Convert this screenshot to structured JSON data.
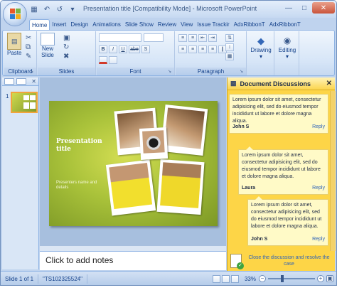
{
  "window": {
    "title": "Presentation title [Compatibility Mode] - Microsoft PowerPoint"
  },
  "tabs": [
    {
      "label": "Home",
      "active": true
    },
    {
      "label": "Insert"
    },
    {
      "label": "Design"
    },
    {
      "label": "Animations"
    },
    {
      "label": "Slide Show"
    },
    {
      "label": "Review"
    },
    {
      "label": "View"
    },
    {
      "label": "Issue Trackir"
    },
    {
      "label": "AdxRibbonT"
    },
    {
      "label": "AdxRibbonT"
    }
  ],
  "ribbon": {
    "clipboard": {
      "label": "Clipboard",
      "paste": "Paste"
    },
    "slides": {
      "label": "Slides",
      "new_slide_1": "New",
      "new_slide_2": "Slide"
    },
    "font": {
      "label": "Font",
      "bold": "B",
      "italic": "I",
      "underline": "U",
      "strike": "abe",
      "shadow": "S"
    },
    "paragraph": {
      "label": "Paragraph"
    },
    "drawing": {
      "label": "Drawing"
    },
    "editing": {
      "label": "Editing"
    }
  },
  "slide_panel": {
    "slide_number": "1"
  },
  "slide": {
    "title": "Presentation title",
    "subtitle": "Presenters name and details"
  },
  "notes": {
    "placeholder": "Click to add notes"
  },
  "task_pane": {
    "title": "Document Discussions",
    "comments": [
      {
        "text": "Lorem ipsum dolor sit amet, consectetur adipisicing elit, sed do eiusmod tempor incididunt ut labore et dolore magna aliqua.",
        "author": "John S",
        "reply": "Reply"
      },
      {
        "text": "Lorem ipsum dolor sit amet, consectetur adipisicing elit, sed do eiusmod tempor incididunt ut labore et dolore magna aliqua.",
        "author": "Laura",
        "reply": "Reply"
      },
      {
        "text": "Lorem ipsum dolor sit amet, consectetur adipisicing elit, sed do eiusmod tempor incididunt ut labore et dolore magna aliqua.",
        "author": "John S",
        "reply": "Reply"
      }
    ],
    "footer_action": "Close the discussion and resolve the case"
  },
  "status_bar": {
    "slide_info": "Slide 1 of 1",
    "theme": "\"TS102325524\"",
    "zoom": "33%"
  },
  "colors": {
    "ribbon_blue": "#c6d9f1",
    "task_pane_yellow": "#fdd547",
    "slide_green": "#a9c23a",
    "thumbnail_highlight": "#f2a43c"
  }
}
